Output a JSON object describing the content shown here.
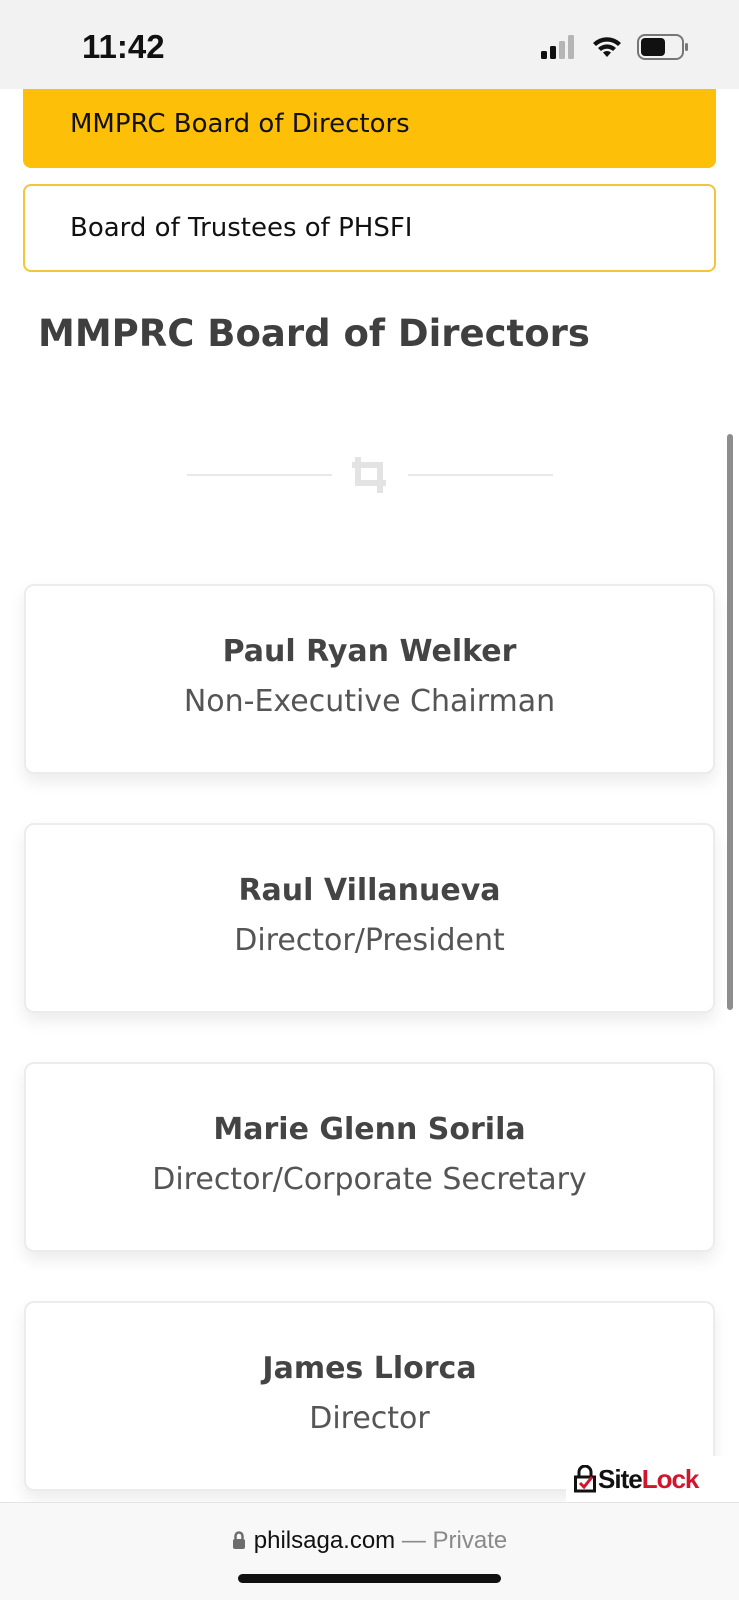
{
  "status_bar": {
    "time": "11:42",
    "icons": [
      "cellular-signal-icon",
      "wifi-icon",
      "battery-icon"
    ]
  },
  "tabs": [
    {
      "label": "MMPRC Board of Directors",
      "active": true
    },
    {
      "label": "Board of Trustees of PHSFI",
      "active": false
    }
  ],
  "page_title": "MMPRC Board of Directors",
  "divider_icon": "crop-icon",
  "members": [
    {
      "name": "Paul Ryan Welker",
      "role": "Non-Executive Chairman"
    },
    {
      "name": "Raul Villanueva",
      "role": "Director/President"
    },
    {
      "name": "Marie Glenn Sorila",
      "role": "Director/Corporate Secretary"
    },
    {
      "name": "James Llorca",
      "role": "Director"
    }
  ],
  "badge": {
    "site": "Site",
    "lock": "Lock"
  },
  "browser": {
    "domain": "philsaga.com",
    "separator": " — ",
    "mode": "Private"
  },
  "colors": {
    "accent": "#fdbf08",
    "tab_border": "#f2c53a",
    "sitelock_red": "#d0152c"
  }
}
